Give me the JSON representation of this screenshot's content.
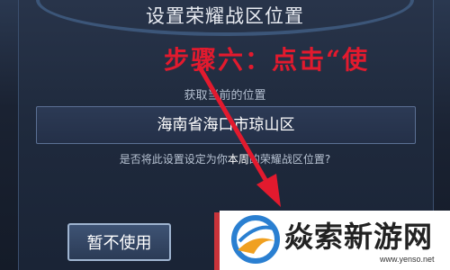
{
  "dialog": {
    "title": "设置荣耀战区位置",
    "subtitle": "获取当前的位置",
    "location_value": "海南省海口市琼山区",
    "question_prefix": "是否将此设置设定为你",
    "question_highlight": "本周",
    "question_suffix": "的荣耀战区位置?",
    "cancel_label": "暂不使用"
  },
  "annotation": {
    "step_text": "步骤六：点击“使",
    "color": "#e21a2e",
    "arrow_icon": "red-arrow-icon"
  },
  "watermark": {
    "name": "焱索新游网",
    "url": "www.yenso.net"
  }
}
